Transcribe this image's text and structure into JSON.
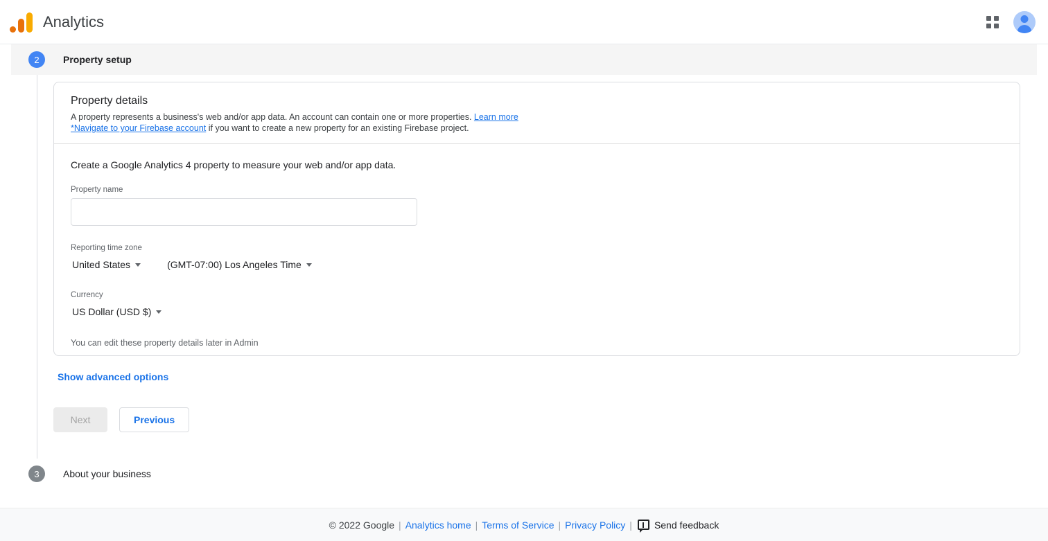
{
  "appbar": {
    "logo_name": "google-analytics-logo",
    "title": "Analytics",
    "apps_icon": "apps-grid-icon",
    "avatar_icon": "account-avatar-icon"
  },
  "steps": {
    "current": {
      "number": "2",
      "label": "Property setup"
    },
    "next": {
      "number": "3",
      "label": "About your business"
    }
  },
  "card": {
    "title": "Property details",
    "description_before_link": "A property represents a business's web and/or app data. An account can contain one or more properties. ",
    "learn_more": "Learn more",
    "firebase_link": "*Navigate to your Firebase account",
    "description_after_link": " if you want to create a new property for an existing Firebase project.",
    "lead": "Create a Google Analytics 4 property to measure your web and/or app data.",
    "property_name": {
      "label": "Property name",
      "value": "",
      "placeholder": ""
    },
    "time_zone": {
      "label": "Reporting time zone",
      "country": "United States",
      "zone": "(GMT-07:00) Los Angeles Time"
    },
    "currency": {
      "label": "Currency",
      "value": "US Dollar (USD $)"
    },
    "hint": "You can edit these property details later in Admin"
  },
  "advanced_options_label": "Show advanced options",
  "buttons": {
    "next": "Next",
    "previous": "Previous"
  },
  "footer": {
    "copyright": "© 2022 Google",
    "sep": "|",
    "analytics_home": "Analytics home",
    "terms": "Terms of Service",
    "privacy": "Privacy Policy",
    "send_feedback": "Send feedback",
    "feedback_icon": "feedback-bubble-icon"
  },
  "colors": {
    "accent_blue": "#1a73e8",
    "step_active": "#4285f4",
    "step_inactive": "#80868b",
    "logo_orange": "#e8710a",
    "logo_yellow": "#f9ab00",
    "band_gray": "#f5f5f5"
  }
}
